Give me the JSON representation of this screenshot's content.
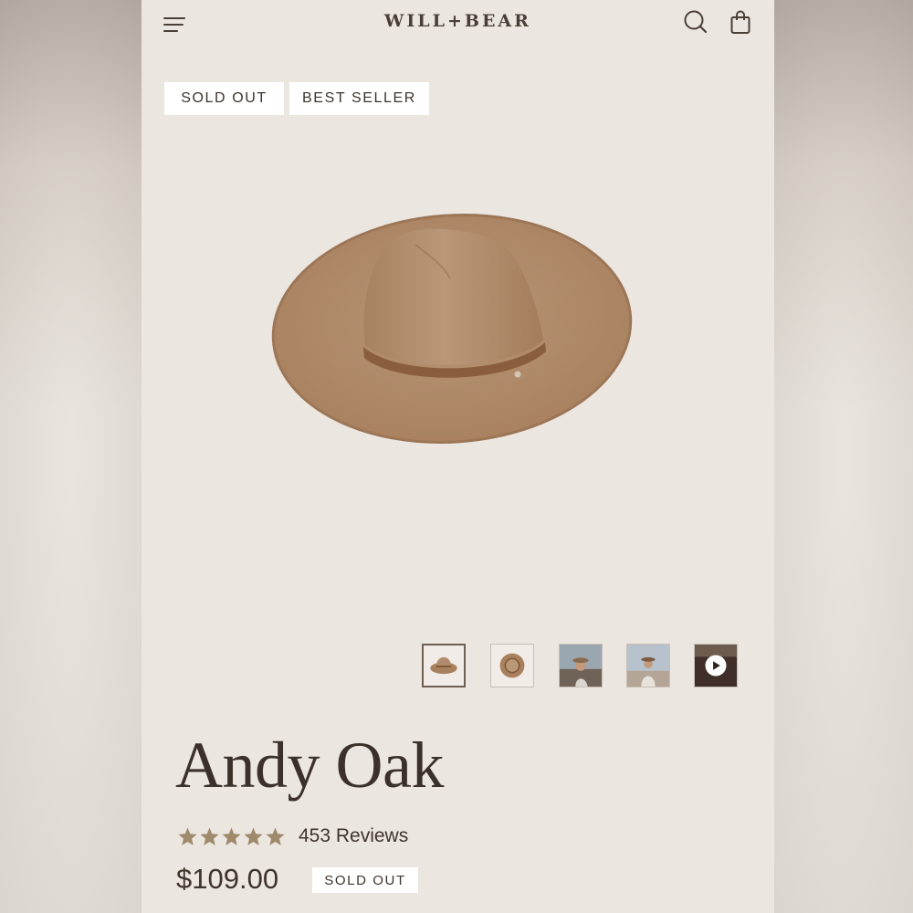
{
  "header": {
    "logo": "WILL+BEAR",
    "menu_icon": "hamburger-menu-icon",
    "search_icon": "search-icon",
    "cart_icon": "shopping-bag-icon"
  },
  "badges": {
    "sold_out": "SOLD OUT",
    "best_seller": "BEST SELLER"
  },
  "gallery": {
    "main_image": "hat-product-photo",
    "thumbnails": [
      {
        "name": "hat-side-view",
        "active": true
      },
      {
        "name": "hat-top-view",
        "active": false
      },
      {
        "name": "model-photo-1",
        "active": false
      },
      {
        "name": "model-photo-2",
        "active": false
      },
      {
        "name": "video",
        "active": false,
        "icon": "play-icon"
      }
    ]
  },
  "product": {
    "title": "Andy Oak",
    "rating": 5,
    "reviews": "453 Reviews",
    "price": "$109.00",
    "status": "SOLD OUT"
  },
  "colors": {
    "screen_bg": "#ece6e1",
    "text_dark": "#3c312a",
    "star": "#a08a6c",
    "hat": "#b08c6c",
    "band": "#8a5e3c"
  }
}
